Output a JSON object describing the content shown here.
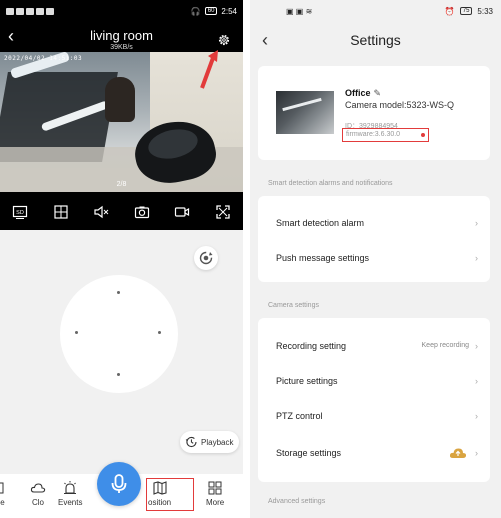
{
  "left": {
    "status": {
      "time": "2:54",
      "battery": "60"
    },
    "header": {
      "title": "living room",
      "rate": "39KB/s"
    },
    "video": {
      "timestamp": "2022/04/02 14:51:03",
      "page": "2/8"
    },
    "toolbar_icons": [
      "sd-icon",
      "grid-icon",
      "mute-icon",
      "camera-icon",
      "record-icon",
      "fullscreen-icon"
    ],
    "playback_label": "Playback",
    "bottom_nav": [
      {
        "label": "age"
      },
      {
        "label": "Clo"
      },
      {
        "label": "Events"
      },
      {
        "label": "osition"
      },
      {
        "label": "More"
      }
    ],
    "highlight_color": "#e23b3b",
    "mic_color": "#3f8ee8"
  },
  "right": {
    "status": {
      "time": "5:33",
      "battery": "75"
    },
    "header": {
      "title": "Settings"
    },
    "device": {
      "name": "Office",
      "model": "Camera model:5323-WS-Q",
      "id": "ID：3929884954",
      "firmware": "firmware:3.6.30.0"
    },
    "sections": {
      "smart": "Smart detection alarms and notifications",
      "camera": "Camera settings",
      "advanced": "Advanced settings"
    },
    "smart_rows": [
      {
        "label": "Smart detection alarm"
      },
      {
        "label": "Push message settings"
      }
    ],
    "camera_rows": [
      {
        "label": "Recording setting",
        "value": "Keep recording"
      },
      {
        "label": "Picture settings"
      },
      {
        "label": "PTZ control"
      },
      {
        "label": "Storage settings"
      }
    ]
  }
}
